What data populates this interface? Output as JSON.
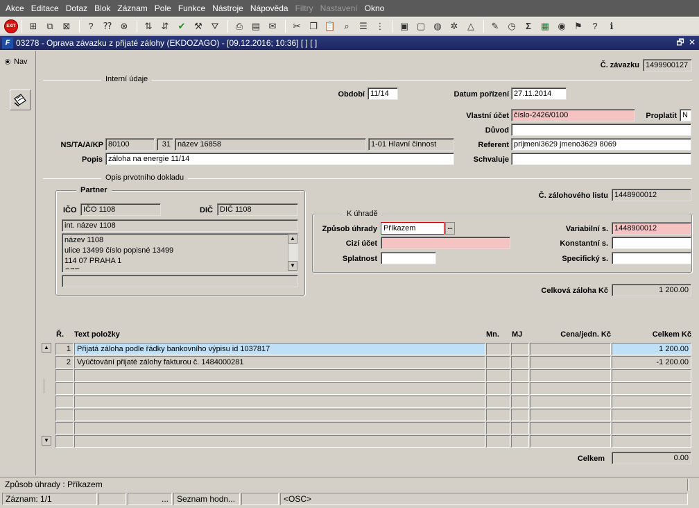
{
  "menu": [
    "Akce",
    "Editace",
    "Dotaz",
    "Blok",
    "Záznam",
    "Pole",
    "Funkce",
    "Nástroje",
    "Nápověda",
    "Filtry",
    "Nastavení",
    "Okno"
  ],
  "menu_disabled": [
    "Filtry",
    "Nastavení"
  ],
  "toolbar": {
    "exit_label": "EXIT",
    "icons": [
      "insert-record-icon",
      "duplicate-record-icon",
      "delete-record-icon",
      "query-icon",
      "query-exec-icon",
      "query-cancel-icon",
      "sort-asc-icon",
      "sort-desc-icon",
      "commit-icon",
      "tools-icon",
      "filter-icon",
      "print-icon",
      "print-preview-icon",
      "mail-icon",
      "cut-icon",
      "copy-icon",
      "paste-icon",
      "lookup-icon",
      "list-icon",
      "tree-icon",
      "clipboard-icon",
      "save-icon",
      "globe-icon",
      "settings-icon",
      "triangle-icon",
      "edit-doc-icon",
      "clock-icon",
      "sum-icon",
      "excel-icon",
      "export-icon",
      "help-wizard-icon",
      "help-icon",
      "info-icon"
    ]
  },
  "window": {
    "title": "03278 - Oprava závazku z přijaté zálohy (EKDOZAGO) - [09.12.2016; 10:36]  [ ]  [ ]",
    "restore": "🗗",
    "close": "✕"
  },
  "nav": {
    "label": "Nav"
  },
  "form": {
    "c_zavazku_label": "Č. závazku",
    "c_zavazku": "1499900127",
    "interni_udaje": "Interní údaje",
    "obdobi_label": "Období",
    "obdobi": "11/14",
    "datum_porizeni_label": "Datum pořízení",
    "datum_porizeni": "27.11.2014",
    "vlastni_ucet_label": "Vlastní účet",
    "vlastni_ucet": "číslo-2426/0100",
    "proplatit_label": "Proplatit",
    "proplatit": "N",
    "duvod_label": "Důvod",
    "duvod": "",
    "ns_label": "NS/TA/A/KP",
    "ns": "80100",
    "ta": "31",
    "a": "název 16858",
    "kp": "1-01 Hlavní činnost",
    "referent_label": "Referent",
    "referent": "prijmeni3629 jmeno3629 8069",
    "popis_label": "Popis",
    "popis": "záloha na energie 11/14",
    "schvaluje_label": "Schvaluje",
    "schvaluje": "",
    "opis_label": "Opis prvotního dokladu",
    "partner_label": "Partner",
    "ico_label": "IČO",
    "ico": "IČO 1108",
    "dic_label": "DIČ",
    "dic": "DIČ 1108",
    "int_nazev": "int. název 1108",
    "address": [
      "název 1108",
      "ulice 13499 číslo popisné 13499",
      "114 07 PRAHA 1",
      "CZE"
    ],
    "address_extra": "",
    "c_zalohoveho_label": "Č. zálohového listu",
    "c_zalohoveho": "1448900012",
    "k_uhrade_label": "K úhradě",
    "zpusob_uhrady_label": "Způsob úhrady",
    "zpusob_uhrady": "Příkazem",
    "lov_button": "...",
    "variabilni_label": "Variabilní s.",
    "variabilni": "1448900012",
    "cizi_ucet_label": "Cizí účet",
    "cizi_ucet": "",
    "konstantni_label": "Konstantní s.",
    "konstantni": "",
    "splatnost_label": "Splatnost",
    "splatnost": "",
    "specificky_label": "Specifický s.",
    "specificky": "",
    "celkova_zaloha_label": "Celková záloha Kč",
    "celkova_zaloha": "1 200.00"
  },
  "grid": {
    "headers": {
      "r": "Ř.",
      "text": "Text položky",
      "mn": "Mn.",
      "mj": "MJ",
      "cena": "Cena/jedn. Kč",
      "celkem": "Celkem Kč"
    },
    "rows": [
      {
        "r": "1",
        "text": "Přijatá záloha podle řádky bankovního výpisu id 1037817",
        "mn": "",
        "mj": "",
        "cena": "",
        "celkem": "1 200.00"
      },
      {
        "r": "2",
        "text": "Vyúčtování přijaté zálohy fakturou č. 1484000281",
        "mn": "",
        "mj": "",
        "cena": "",
        "celkem": "-1 200.00"
      },
      {
        "r": "",
        "text": "",
        "mn": "",
        "mj": "",
        "cena": "",
        "celkem": ""
      },
      {
        "r": "",
        "text": "",
        "mn": "",
        "mj": "",
        "cena": "",
        "celkem": ""
      },
      {
        "r": "",
        "text": "",
        "mn": "",
        "mj": "",
        "cena": "",
        "celkem": ""
      },
      {
        "r": "",
        "text": "",
        "mn": "",
        "mj": "",
        "cena": "",
        "celkem": ""
      },
      {
        "r": "",
        "text": "",
        "mn": "",
        "mj": "",
        "cena": "",
        "celkem": ""
      },
      {
        "r": "",
        "text": "",
        "mn": "",
        "mj": "",
        "cena": "",
        "celkem": ""
      }
    ],
    "celkem_label": "Celkem",
    "celkem": "0.00"
  },
  "status": {
    "hint": "Způsob úhrady : Příkazem",
    "zaznam": "Záznam: 1/1",
    "dots": "...",
    "seznam": "Seznam hodn...",
    "osc": "<OSC>"
  }
}
